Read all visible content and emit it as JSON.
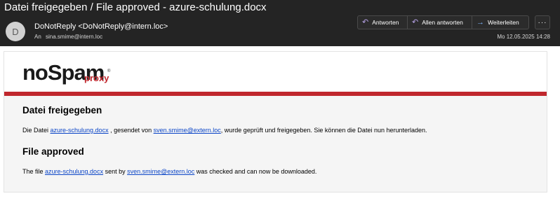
{
  "header": {
    "subject": "Datei freigegeben / File approved - azure-schulung.docx",
    "avatar_initial": "D",
    "sender": "DoNotReply <DoNotReply@intern.loc>",
    "to_label": "An",
    "recipient": "sina.smime@intern.loc",
    "date": "Mo 12.05.2025 14:28",
    "actions": {
      "reply": "Antworten",
      "reply_all": "Allen antworten",
      "forward": "Weiterleiten",
      "more": "···"
    }
  },
  "icons": {
    "reply": "reply-arrow-icon",
    "reply_all": "reply-all-arrow-icon",
    "forward": "forward-arrow-icon",
    "more": "more-ellipsis-icon"
  },
  "colors": {
    "header_bg": "#242424",
    "brand_red": "#c0272d",
    "link": "#0b45c7",
    "content_bg": "#f5f5f5"
  },
  "body": {
    "logo": {
      "main": "noSpam",
      "sub": "proxy",
      "reg": "®"
    },
    "de": {
      "heading": "Datei freigegeben",
      "text_1": "Die Datei ",
      "file_link": "azure-schulung.docx",
      "text_2": " , gesendet von ",
      "sender_link": "sven.smime@extern.loc",
      "text_3": ", wurde geprüft und freigegeben. Sie können die Datei nun herunterladen."
    },
    "en": {
      "heading": "File approved",
      "text_1": "The file ",
      "file_link": "azure-schulung.docx",
      "text_2": " sent by ",
      "sender_link": "sven.smime@extern.loc",
      "text_3": " was checked and can now be downloaded."
    }
  }
}
